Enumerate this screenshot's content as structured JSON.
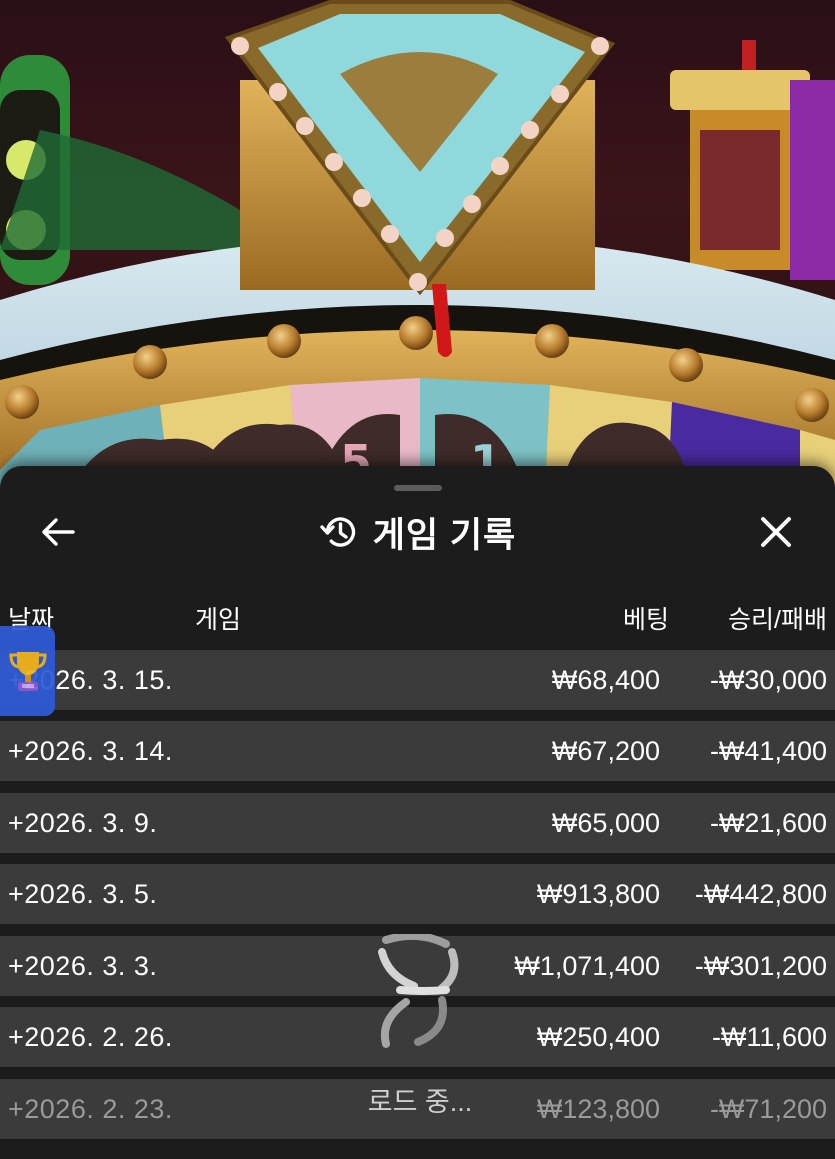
{
  "header": {
    "title": "게임 기록",
    "back_icon": "arrow-left-icon",
    "history_icon": "history-clock-icon",
    "close_icon": "close-icon"
  },
  "columns": {
    "date": "날짜",
    "game": "게임",
    "bet": "베팅",
    "result": "승리/패배"
  },
  "rows": [
    {
      "date": "+2026. 3. 15.",
      "bet": "₩68,400",
      "result": "-₩30,000"
    },
    {
      "date": "+2026. 3. 14.",
      "bet": "₩67,200",
      "result": "-₩41,400"
    },
    {
      "date": "+2026. 3. 9.",
      "bet": "₩65,000",
      "result": "-₩21,600"
    },
    {
      "date": "+2026. 3. 5.",
      "bet": "₩913,800",
      "result": "-₩442,800"
    },
    {
      "date": "+2026. 3. 3.",
      "bet": "₩1,071,400",
      "result": "-₩301,200"
    },
    {
      "date": "+2026. 2. 26.",
      "bet": "₩250,400",
      "result": "-₩11,600"
    },
    {
      "date": "+2026. 2. 23.",
      "bet": "₩123,800",
      "result": "-₩71,200"
    }
  ],
  "loading": {
    "text": "로드 중...",
    "icon": "loading-spinner-icon"
  },
  "trophy_widget": {
    "icon": "trophy-icon"
  },
  "colors": {
    "sheet_bg": "#1c1c1c",
    "row_bg": "#3b3b3b",
    "widget_blue": "#2f5bd6",
    "pointer_cyan": "#8fd9dd"
  }
}
